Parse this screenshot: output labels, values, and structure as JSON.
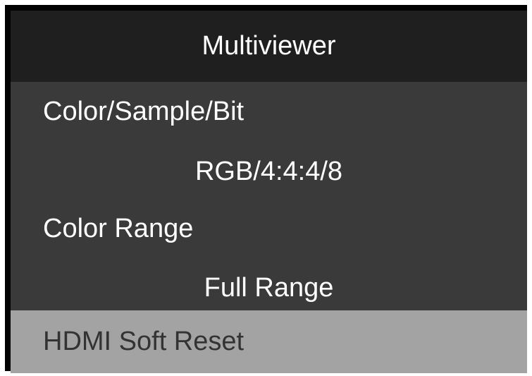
{
  "header": {
    "title": "Multiviewer"
  },
  "menu": {
    "items": [
      {
        "label": "Color/Sample/Bit",
        "value": "RGB/4:4:4/8"
      },
      {
        "label": "Color Range",
        "value": "Full Range"
      }
    ],
    "selected_item": {
      "label": "HDMI Soft Reset"
    }
  },
  "colors": {
    "header_bg": "#1f1f1f",
    "panel_bg": "#3a3a3a",
    "selected_bg": "#a3a3a3",
    "frame": "#000000"
  }
}
